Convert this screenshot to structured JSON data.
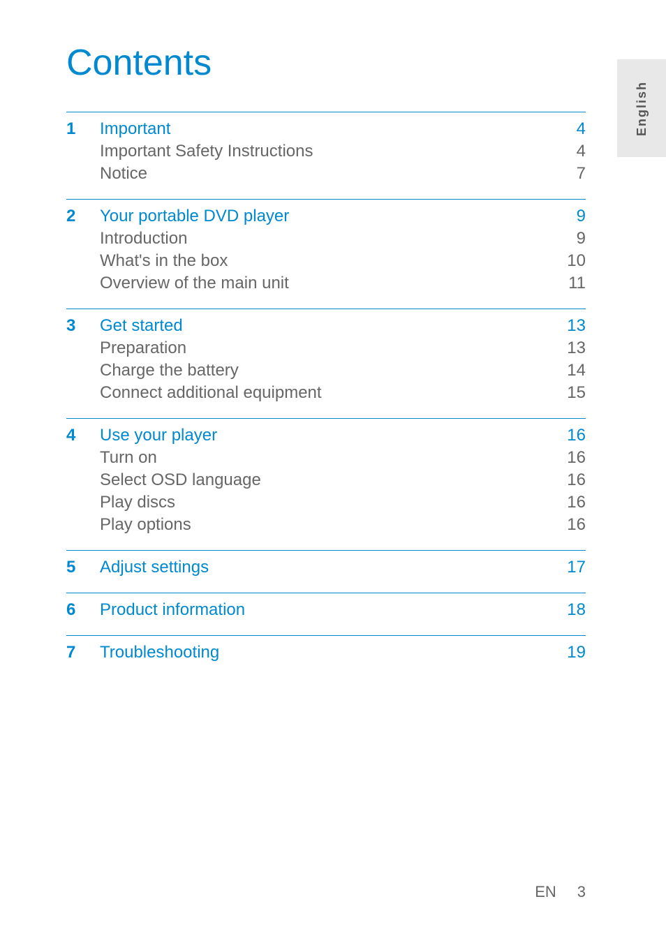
{
  "title": "Contents",
  "language_tab": "English",
  "footer": {
    "lang_code": "EN",
    "page_number": "3"
  },
  "sections": [
    {
      "number": "1",
      "title": "Important",
      "page": "4",
      "items": [
        {
          "title": "Important Safety Instructions",
          "page": "4"
        },
        {
          "title": "Notice",
          "page": "7"
        }
      ]
    },
    {
      "number": "2",
      "title": "Your portable DVD player",
      "page": "9",
      "items": [
        {
          "title": "Introduction",
          "page": "9"
        },
        {
          "title": "What's in the box",
          "page": "10"
        },
        {
          "title": "Overview of the main unit",
          "page": "11"
        }
      ]
    },
    {
      "number": "3",
      "title": "Get started",
      "page": "13",
      "items": [
        {
          "title": "Preparation",
          "page": "13"
        },
        {
          "title": "Charge the battery",
          "page": "14"
        },
        {
          "title": "Connect additional equipment",
          "page": "15"
        }
      ]
    },
    {
      "number": "4",
      "title": "Use your player",
      "page": "16",
      "items": [
        {
          "title": "Turn on",
          "page": "16"
        },
        {
          "title": "Select OSD language",
          "page": "16"
        },
        {
          "title": "Play discs",
          "page": "16"
        },
        {
          "title": "Play options",
          "page": "16"
        }
      ]
    },
    {
      "number": "5",
      "title": "Adjust settings",
      "page": "17",
      "items": []
    },
    {
      "number": "6",
      "title": "Product information",
      "page": "18",
      "items": []
    },
    {
      "number": "7",
      "title": "Troubleshooting",
      "page": "19",
      "items": []
    }
  ]
}
